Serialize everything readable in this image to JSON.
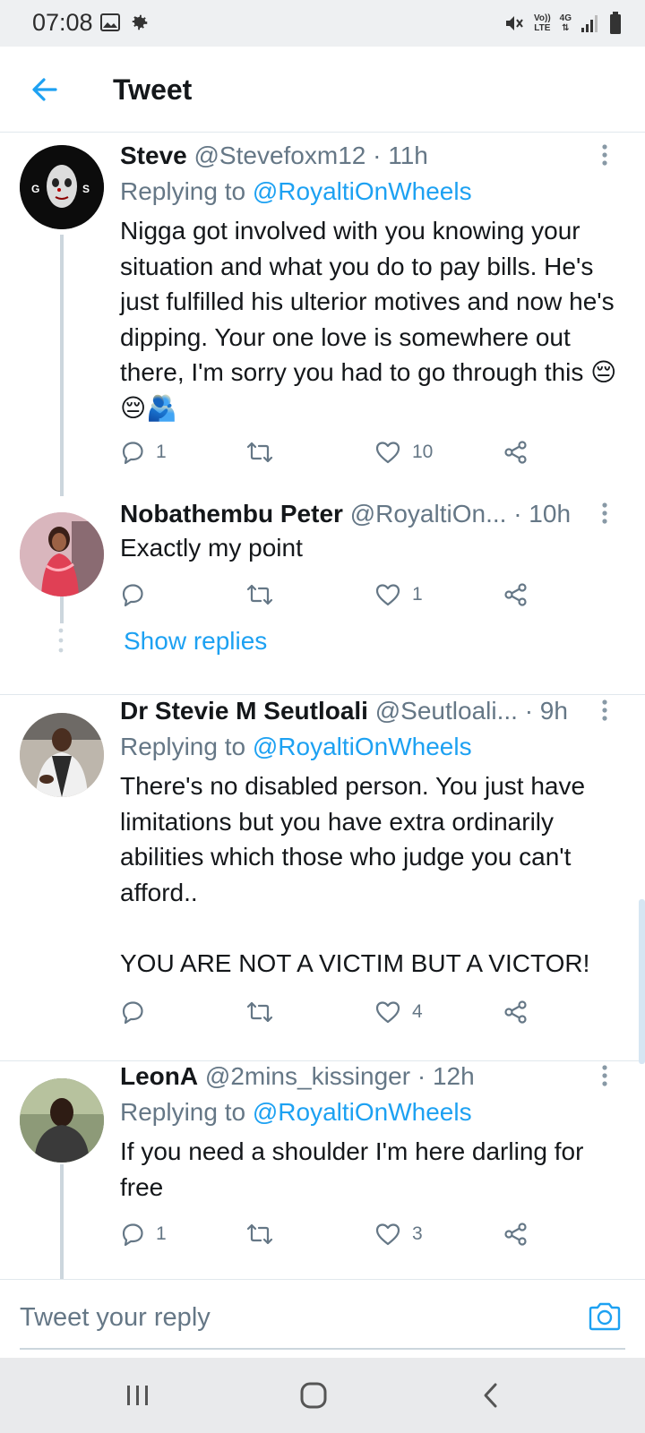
{
  "status_bar": {
    "time": "07:08",
    "icons": [
      "gallery-icon",
      "gear-icon",
      "mute-icon",
      "volte-icon",
      "4g-icon",
      "signal-icon",
      "battery-icon"
    ],
    "volte_label_top": "Vo))",
    "volte_label_bottom": "LTE",
    "network_label": "4G"
  },
  "header": {
    "back_icon": "arrow-left-icon",
    "title": "Tweet"
  },
  "colors": {
    "accent": "#1da1f2",
    "muted": "#657786",
    "text": "#14171a",
    "divider": "#e1e8ed"
  },
  "tweets": [
    {
      "name": "Steve",
      "handle": "@Stevefoxm12",
      "time": "· 11h",
      "replying_prefix": "Replying to",
      "replying_to": "@RoyaltiOnWheels",
      "text": "Nigga got involved with you knowing your situation and what you do to pay bills. He's just fulfilled his ulterior motives and now he's dipping. Your one love is somewhere out there, I'm sorry you had to go through this 😔😔🫂",
      "replies": "1",
      "retweets": "",
      "likes": "10"
    },
    {
      "name": "Nobathembu Peter",
      "handle": "@RoyaltiOn...",
      "time": "· 10h",
      "text": "Exactly my point",
      "replies": "",
      "retweets": "",
      "likes": "1",
      "show_replies": "Show replies"
    },
    {
      "name": "Dr Stevie M Seutloali",
      "handle": "@Seutloali...",
      "time": "· 9h",
      "replying_prefix": "Replying to",
      "replying_to": "@RoyaltiOnWheels",
      "text": "There's no disabled person. You just have limitations but you have extra ordinarily abilities which those who judge you can't afford..\n\nYOU ARE NOT A VICTIM BUT A VICTOR!",
      "replies": "",
      "retweets": "",
      "likes": "4"
    },
    {
      "name": "LeonA",
      "handle": "@2mins_kissinger",
      "time": "· 12h",
      "replying_prefix": "Replying to",
      "replying_to": "@RoyaltiOnWheels",
      "text": "If you need a shoulder I'm here darling for free",
      "replies": "1",
      "retweets": "",
      "likes": "3"
    }
  ],
  "reply_bar": {
    "placeholder": "Tweet your reply",
    "camera_icon": "camera-icon"
  },
  "nav_bar": {
    "icons": [
      "recents-icon",
      "home-icon",
      "back-icon"
    ]
  }
}
